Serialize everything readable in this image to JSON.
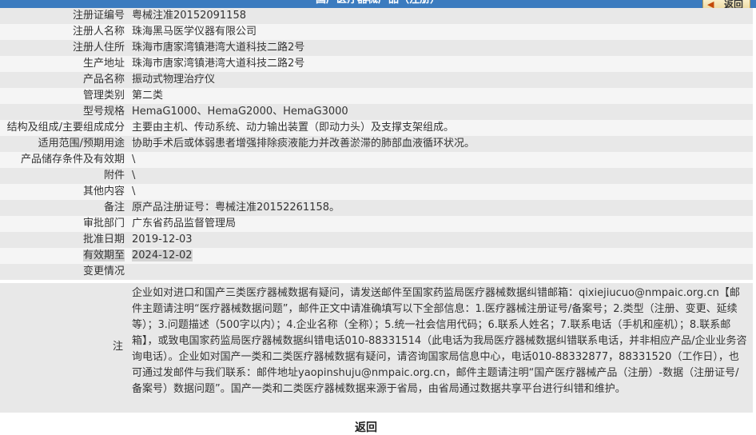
{
  "header": {
    "title": "国产医疗器械产品（注册）",
    "back_label": "返回"
  },
  "rows": [
    {
      "key": "注册证编号",
      "value": "粤械注准20152091158"
    },
    {
      "key": "注册人名称",
      "value": "珠海黑马医学仪器有限公司"
    },
    {
      "key": "注册人住所",
      "value": "珠海市唐家湾镇港湾大道科技二路2号"
    },
    {
      "key": "生产地址",
      "value": "珠海市唐家湾镇港湾大道科技二路2号"
    },
    {
      "key": "产品名称",
      "value": "振动式物理治疗仪"
    },
    {
      "key": "管理类别",
      "value": "第二类"
    },
    {
      "key": "型号规格",
      "value": "HemaG1000、HemaG2000、HemaG3000"
    },
    {
      "key": "结构及组成/主要组成成分",
      "value": "主要由主机、传动系统、动力输出装置（即动力头）及支撑支架组成。"
    },
    {
      "key": "适用范围/预期用途",
      "value": "协助手术后或体弱患者增强排除痰液能力并改善淤滞的肺部血液循环状况。"
    },
    {
      "key": "产品储存条件及有效期",
      "value": "\\"
    },
    {
      "key": "附件",
      "value": "\\"
    },
    {
      "key": "其他内容",
      "value": "\\"
    },
    {
      "key": "备注",
      "value": "原产品注册证号：粤械注准20152261158。"
    },
    {
      "key": "审批部门",
      "value": "广东省药品监督管理局"
    },
    {
      "key": "批准日期",
      "value": "2019-12-03"
    },
    {
      "key": "有效期至",
      "value": "2024-12-02"
    },
    {
      "key": "变更情况",
      "value": ""
    }
  ],
  "note": {
    "key": "注",
    "text": "企业如对进口和国产三类医疗器械数据有疑问，请发送邮件至国家药监局医疗器械数据纠错邮箱：qixiejiucuo@nmpaic.org.cn【邮件主题请注明“医疗器械数据问题”，邮件正文中请准确填写以下全部信息：1.医疗器械注册证号/备案号；2.类型（注册、变更、延续等）；3.问题描述（500字以内）；4.企业名称（全称）；5.统一社会信用代码；6.联系人姓名；7.联系电话（手机和座机）；8.联系邮箱】，或致电国家药监局医疗器械数据纠错电话010-88331514（此电话为我局医疗器械数据纠错联系电话，并非相应产品/企业业务咨询电话）。企业如对国产一类和二类医疗器械数据有疑问，请咨询国家局信息中心，电话010-88332877，88331520（工作日），也可通过发邮件与我们联系：邮件地址yaopinshuju@nmpaic.org.cn，邮件主题请注明“国产医疗器械产品（注册）-数据（注册证号/备案号）数据问题”。国产一类和二类医疗器械数据来源于省局，由省局通过数据共享平台进行纠错和维护。"
  },
  "footer": {
    "back_label": "返回"
  },
  "colors": {
    "header_bg": "#3b7bbf",
    "row_dark": "#e8e8e8",
    "row_light": "#f5f5f5"
  }
}
